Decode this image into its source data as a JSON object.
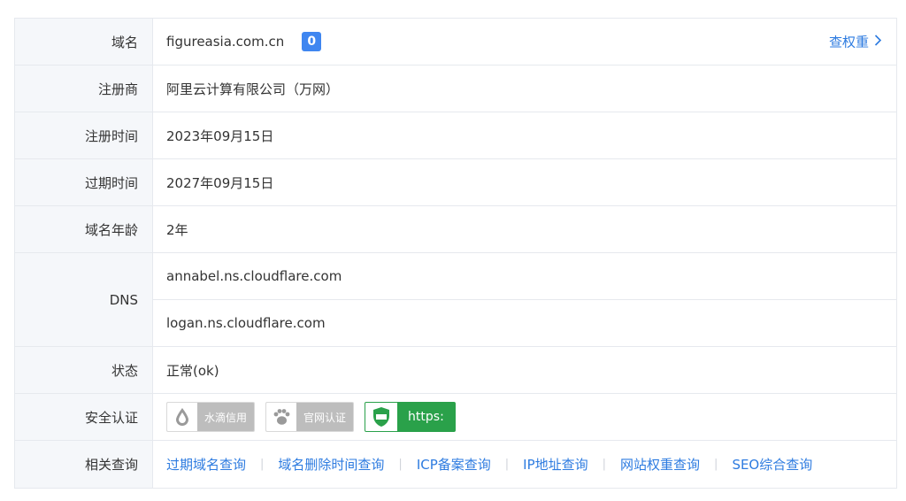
{
  "rows": {
    "domain": {
      "label": "域名",
      "value": "figureasia.com.cn",
      "badge": "0",
      "link": "查权重"
    },
    "registrar": {
      "label": "注册商",
      "value": "阿里云计算有限公司（万网）"
    },
    "reg_time": {
      "label": "注册时间",
      "value": "2023年09月15日"
    },
    "exp_time": {
      "label": "过期时间",
      "value": "2027年09月15日"
    },
    "age": {
      "label": "域名年龄",
      "value": "2年"
    },
    "dns": {
      "label": "DNS",
      "values": [
        "annabel.ns.cloudflare.com",
        "logan.ns.cloudflare.com"
      ]
    },
    "status": {
      "label": "状态",
      "value": "正常(ok)"
    },
    "cert": {
      "label": "安全认证",
      "badges": [
        "水滴信用",
        "官网认证",
        "https:"
      ]
    },
    "related": {
      "label": "相关查询",
      "links": [
        "过期域名查询",
        "域名删除时间查询",
        "ICP备案查询",
        "IP地址查询",
        "网站权重查询",
        "SEO综合查询"
      ]
    }
  },
  "colors": {
    "link": "#2d7be0",
    "badge": "#3f86f0",
    "https": "#2aa14a",
    "label_bg": "#f5f7fa"
  }
}
